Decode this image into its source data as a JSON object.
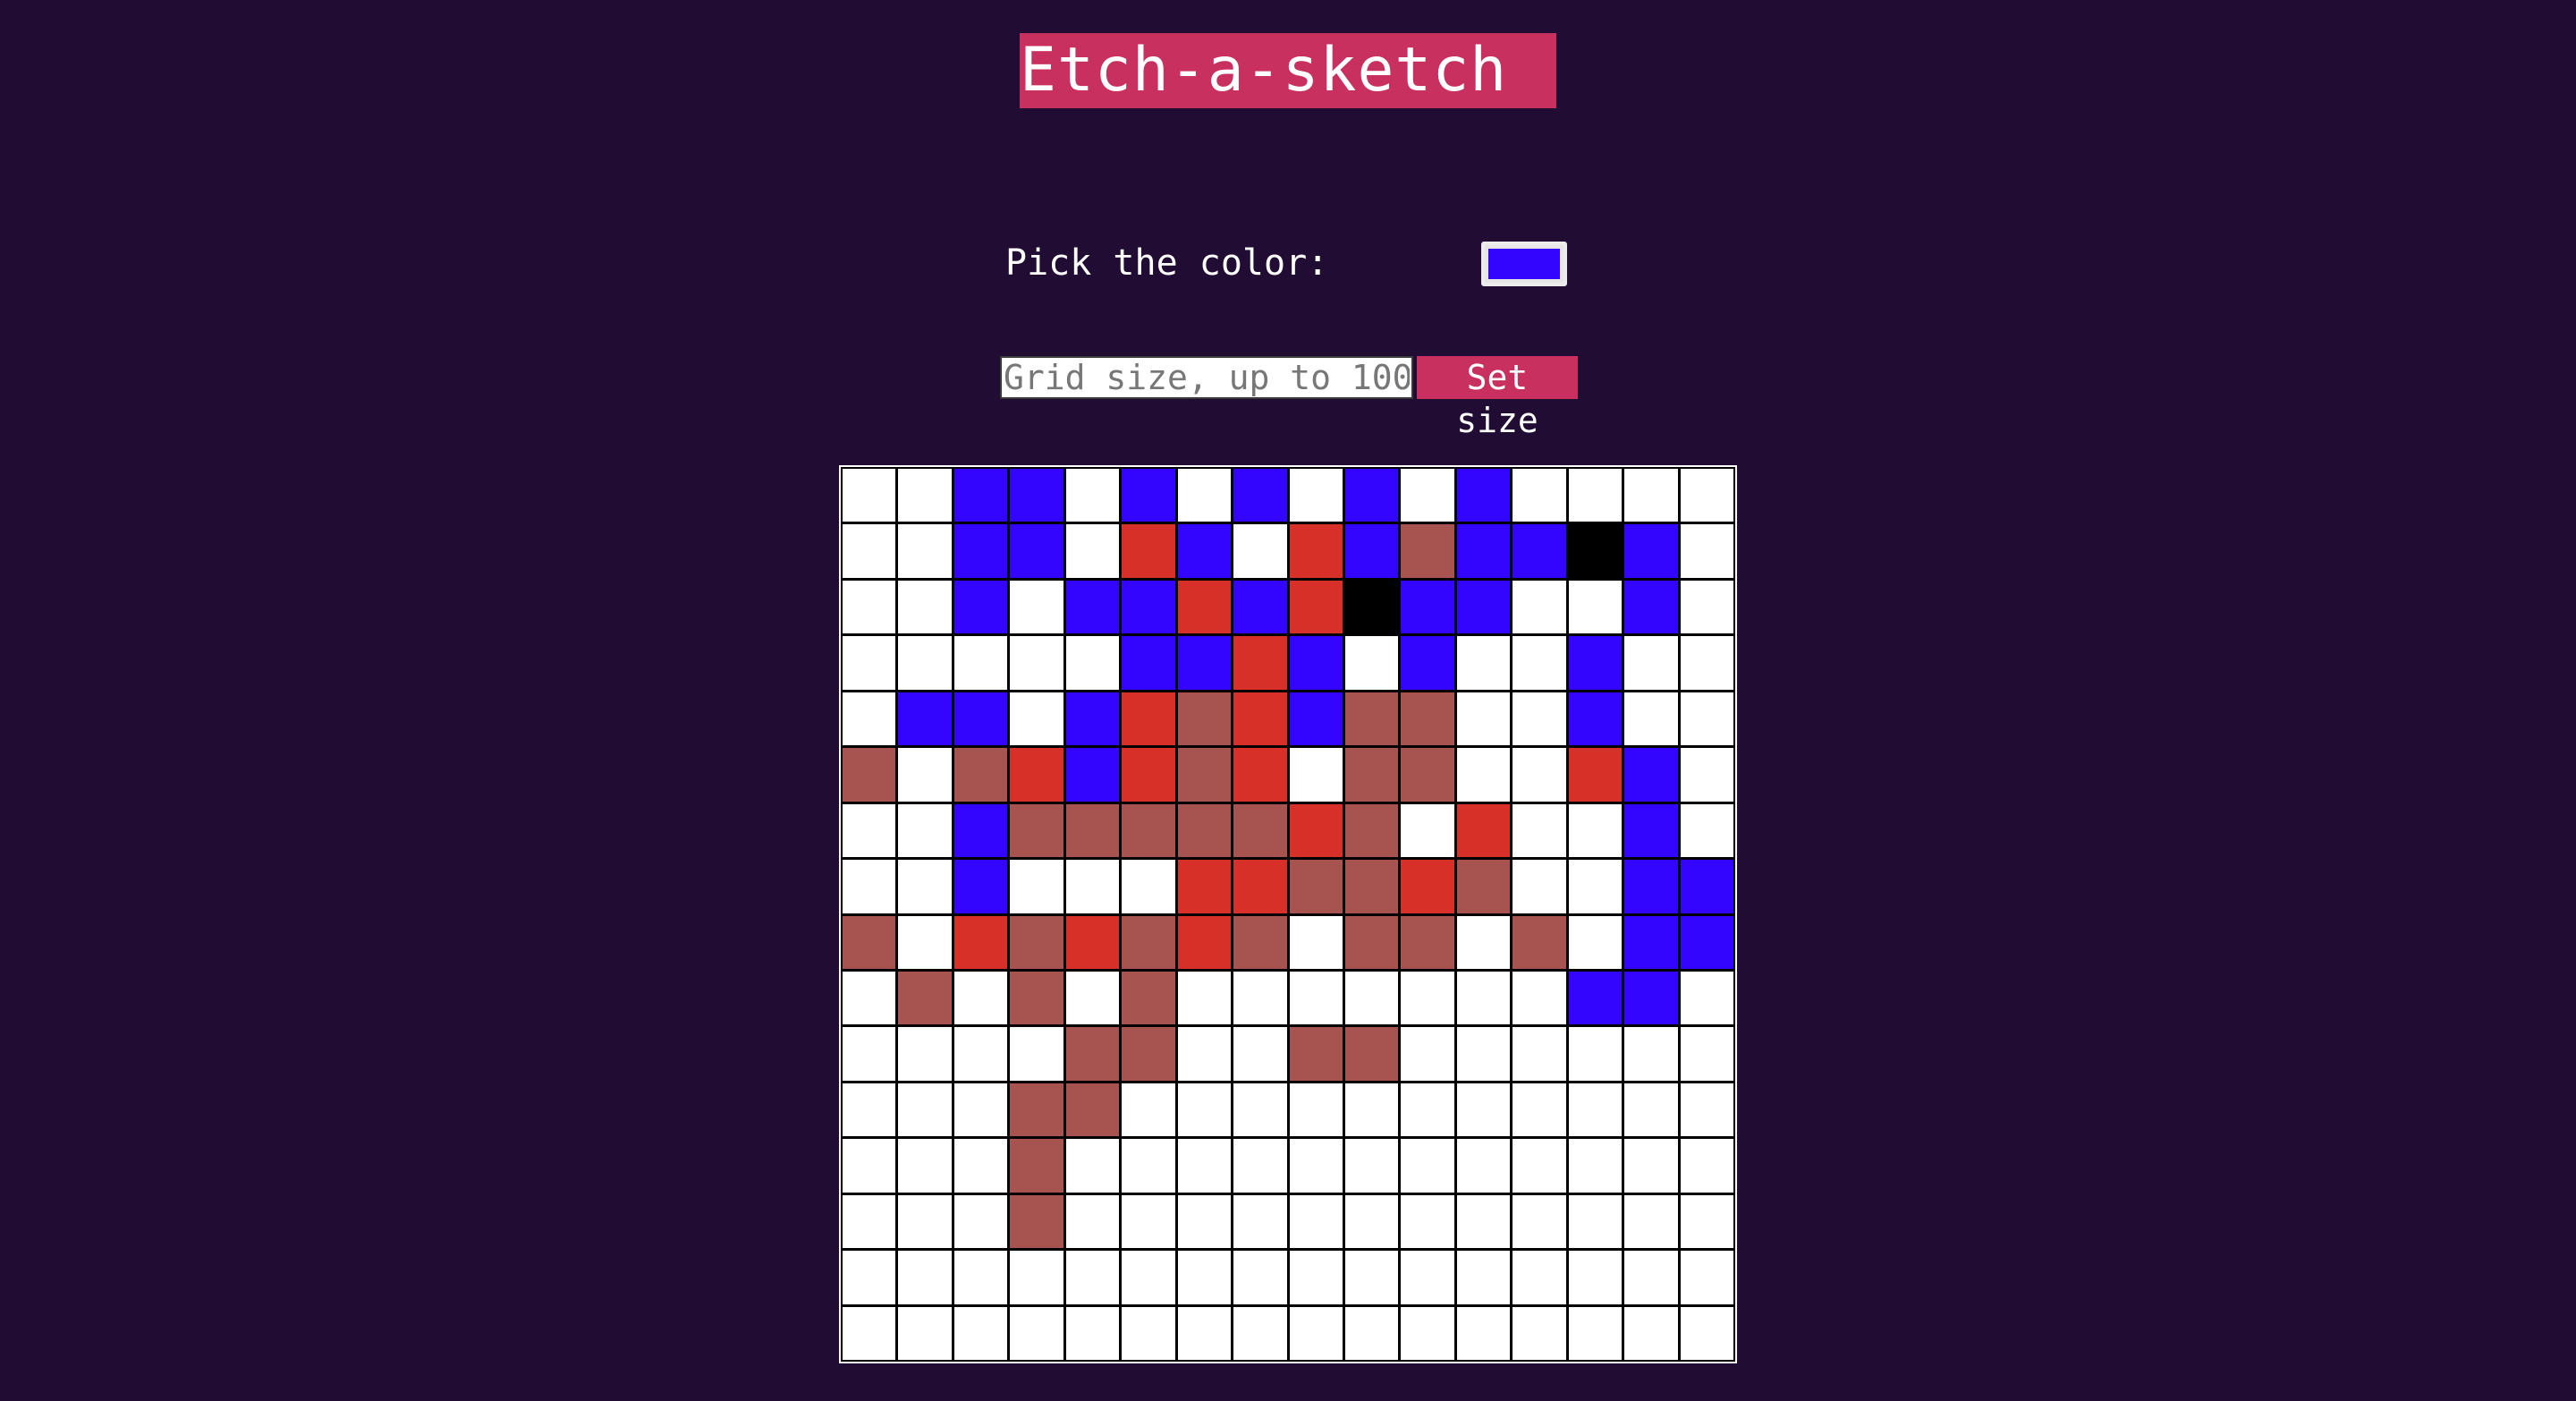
{
  "title": "Etch-a-sketch",
  "picker": {
    "label": "Pick the color:",
    "value": "#3305ff"
  },
  "grid_size": {
    "placeholder": "Grid size, up to 100",
    "value": "",
    "button_label": "Set size"
  },
  "colors": {
    "W": "#ffffff",
    "B": "#3305ff",
    "R": "#d63028",
    "M": "#a75450",
    "K": "#000000"
  },
  "grid": {
    "size": 16,
    "rows": [
      "WWBBWBWBWBWBWWWW",
      "WWBBWRBWRBMBBKBW",
      "WWBWBBRBRKBBWWBW",
      "WWWWWBBRBWBWWBWW",
      "WBBWBRMRBMMWWBWW",
      "MWMRBRMRWMMWWRBW",
      "WWBMMMMMRMWRWWBW",
      "WWBWWWRRMMRMWWBB",
      "MWRMRMRMWMMWMWBB",
      "WMWMWMWWWWWWWBBW",
      "WWWWMMWWMMWWWWWW",
      "WWWMMWWWWWWWWWWW",
      "WWWMWWWWWWWWWWWW",
      "WWWMWWWWWWWWWWWW",
      "WWWWWWWWWWWWWWWW",
      "WWWWWWWWWWWWWWWW"
    ]
  }
}
